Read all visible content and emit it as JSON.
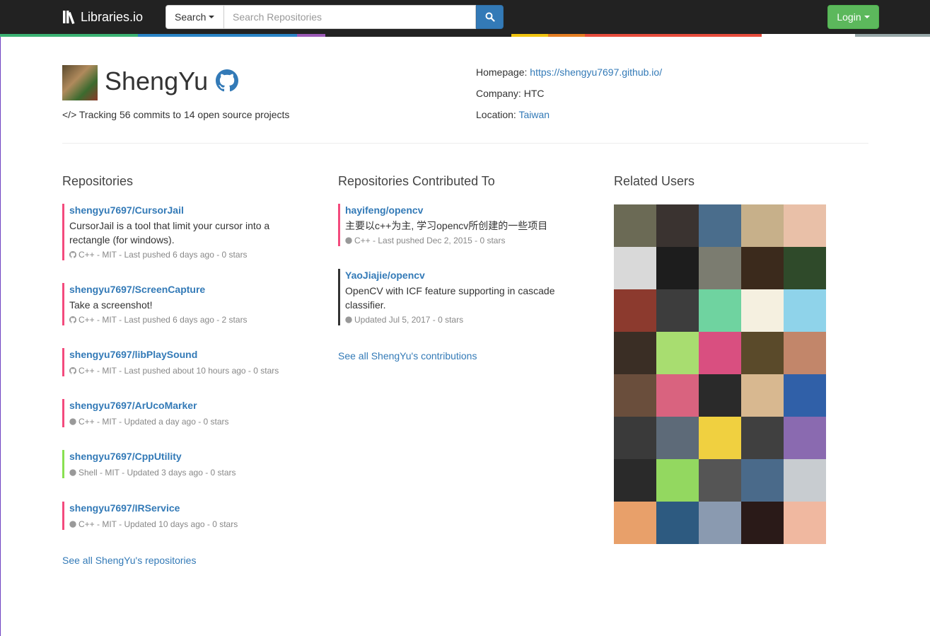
{
  "nav": {
    "brand": "Libraries.io",
    "search_button": "Search",
    "search_placeholder": "Search Repositories",
    "login": "Login"
  },
  "stripe_colors": [
    "#3bb273",
    "#2a84c6",
    "#2a84c6",
    "#9b59b6",
    "#222",
    "#f1c40f",
    "#e67e22",
    "#e74c3c",
    "#e74c3c",
    "#ffffff",
    "#95a5a6"
  ],
  "profile": {
    "name": "ShengYu",
    "tracking": "Tracking 56 commits to 14 open source projects",
    "homepage_label": "Homepage: ",
    "homepage": "https://shengyu7697.github.io/",
    "company_label": "Company: ",
    "company": "HTC",
    "location_label": "Location: ",
    "location": "Taiwan"
  },
  "repositories": {
    "title": "Repositories",
    "items": [
      {
        "name": "shengyu7697/CursorJail",
        "desc1": "CursorJail is a tool that limit your cursor into a",
        "desc2": "rectangle (for windows).",
        "meta": "C++ - MIT - Last pushed 6 days ago - 0 stars",
        "color": "#f34b7d"
      },
      {
        "name": "shengyu7697/ScreenCapture",
        "desc1": "Take a screenshot!",
        "desc2": "",
        "meta": "C++ - MIT - Last pushed 6 days ago - 2 stars",
        "color": "#f34b7d"
      },
      {
        "name": "shengyu7697/libPlaySound",
        "desc1": "",
        "desc2": "",
        "meta": "C++ - MIT - Last pushed about 10 hours ago - 0 stars",
        "color": "#f34b7d"
      },
      {
        "name": "shengyu7697/ArUcoMarker",
        "desc1": "",
        "desc2": "",
        "meta": "C++ - MIT - Updated a day ago - 0 stars",
        "color": "#f34b7d"
      },
      {
        "name": "shengyu7697/CppUtility",
        "desc1": "",
        "desc2": "",
        "meta": "Shell - MIT - Updated 3 days ago - 0 stars",
        "color": "#89e051"
      },
      {
        "name": "shengyu7697/IRService",
        "desc1": "",
        "desc2": "",
        "meta": "C++ - MIT - Updated 10 days ago - 0 stars",
        "color": "#f34b7d"
      }
    ],
    "see_all": "See all ShengYu's repositories"
  },
  "contributed": {
    "title": "Repositories Contributed To",
    "items": [
      {
        "name": "hayifeng/opencv",
        "desc1": "主要以c++为主, 学习opencv所创建的一些项目",
        "desc2": "",
        "meta": "C++ - Last pushed Dec 2, 2015 - 0 stars",
        "color": "#f34b7d"
      },
      {
        "name": "YaoJiajie/opencv",
        "desc1": "OpenCV with ICF feature supporting in cascade",
        "desc2": "classifier.",
        "meta": "Updated Jul 5, 2017 - 0 stars",
        "color": "#333333"
      }
    ],
    "see_all": "See all ShengYu's contributions"
  },
  "related": {
    "title": "Related Users",
    "avatars": [
      "#6b6a55",
      "#3a3330",
      "#4a6d8c",
      "#c7b08a",
      "#e9c0a8",
      "#d9d9d9",
      "#1d1d1d",
      "#7b7c70",
      "#3b2a1c",
      "#2f4a2a",
      "#8c3a2e",
      "#3d3d3d",
      "#6fd3a0",
      "#f5f0e0",
      "#8fd3ea",
      "#3a2e25",
      "#a8dd70",
      "#d94f80",
      "#5a4a2a",
      "#c2866a",
      "#6a4e3c",
      "#d9637f",
      "#2a2a2a",
      "#d8b890",
      "#3060a8",
      "#3a3a3a",
      "#5d6a78",
      "#f0d040",
      "#404040",
      "#8a6ab0",
      "#2a2a2a",
      "#93d860",
      "#555555",
      "#4a6a8a",
      "#c8ccd0",
      "#e8a06a",
      "#2d5a80",
      "#8a9ab0",
      "#2a1a18",
      "#f0b8a0"
    ]
  }
}
